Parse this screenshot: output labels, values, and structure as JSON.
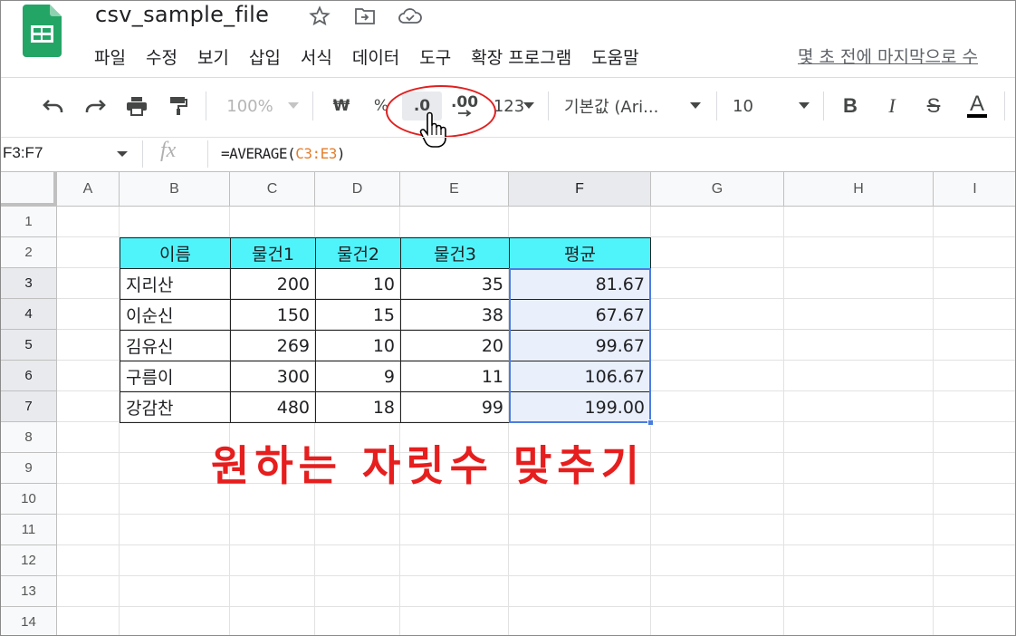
{
  "app": {
    "doc_title": "csv_sample_file",
    "menus": [
      "파일",
      "수정",
      "보기",
      "삽입",
      "서식",
      "데이터",
      "도구",
      "확장 프로그램",
      "도움말"
    ],
    "last_edit": "몇 초 전에 마지막으로 수"
  },
  "toolbar": {
    "zoom": "100%",
    "currency": "₩",
    "percent": "%",
    "decrease_decimal": ".0",
    "increase_decimal": ".00",
    "more_formats": "123",
    "font": "기본값 (Ari...",
    "font_size": "10",
    "bold": "B",
    "italic": "I",
    "strike": "S",
    "text_color": "A"
  },
  "formula_bar": {
    "name_box": "F3:F7",
    "fx": "fx",
    "formula_prefix": "=AVERAGE(",
    "formula_ref": "C3:E3",
    "formula_suffix": ")"
  },
  "columns": [
    "A",
    "B",
    "C",
    "D",
    "E",
    "F",
    "G",
    "H",
    "I"
  ],
  "rows": [
    "1",
    "2",
    "3",
    "4",
    "5",
    "6",
    "7",
    "8",
    "9",
    "10",
    "11",
    "12",
    "13",
    "14"
  ],
  "table": {
    "headers": [
      "이름",
      "물건1",
      "물건2",
      "물건3",
      "평균"
    ],
    "rows": [
      [
        "지리산",
        "200",
        "10",
        "35",
        "81.67"
      ],
      [
        "이순신",
        "150",
        "15",
        "38",
        "67.67"
      ],
      [
        "김유신",
        "269",
        "10",
        "20",
        "99.67"
      ],
      [
        "구름이",
        "300",
        "9",
        "11",
        "106.67"
      ],
      [
        "강감찬",
        "480",
        "18",
        "99",
        "199.00"
      ]
    ]
  },
  "annotation": {
    "caption": "원하는 자릿수 맞추기",
    "highlight_color": "#e02020"
  },
  "colors": {
    "header_fill": "#4ff4fb",
    "selection": "#4a7de0",
    "brand_green": "#23a566"
  }
}
